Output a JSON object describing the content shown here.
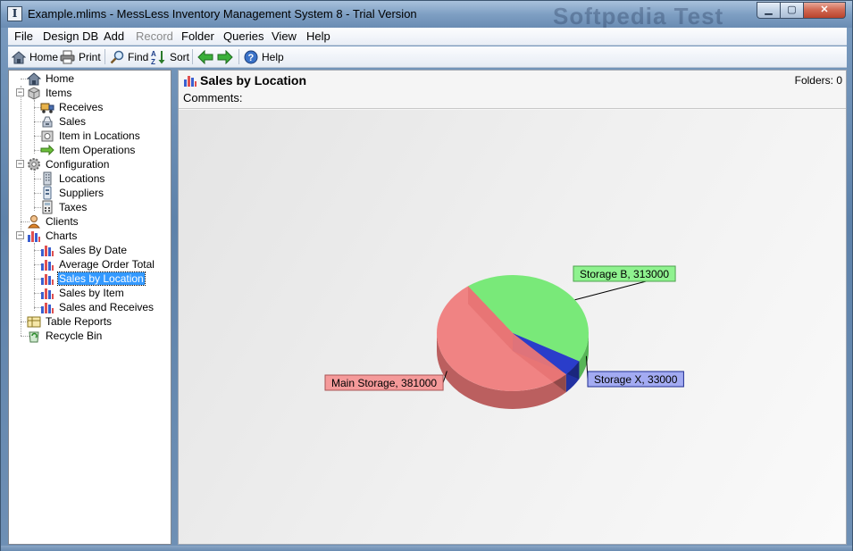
{
  "window": {
    "title": "Example.mlims - MessLess Inventory Management System 8 - Trial Version",
    "watermark": "Softpedia Test",
    "min_glyph": "▁",
    "max_glyph": "▢",
    "close_glyph": "✕"
  },
  "menubar": {
    "items": [
      {
        "label": "File",
        "enabled": true
      },
      {
        "label": "Design DB",
        "enabled": true
      },
      {
        "label": "Add",
        "enabled": true
      },
      {
        "label": "Record",
        "enabled": false
      },
      {
        "label": "Folder",
        "enabled": true
      },
      {
        "label": "Queries",
        "enabled": true
      },
      {
        "label": "View",
        "enabled": true
      },
      {
        "label": "Help",
        "enabled": true
      }
    ]
  },
  "toolbar": {
    "home_label": "Home",
    "print_label": "Print",
    "find_label": "Find",
    "sort_label": "Sort",
    "help_label": "Help"
  },
  "sidebar": {
    "items": [
      {
        "label": "Home",
        "icon": "home-icon"
      },
      {
        "label": "Items",
        "icon": "items-icon"
      },
      {
        "label": "Receives",
        "icon": "truck-icon"
      },
      {
        "label": "Sales",
        "icon": "sales-icon"
      },
      {
        "label": "Item in Locations",
        "icon": "item-location-icon"
      },
      {
        "label": "Item Operations",
        "icon": "arrow-right-icon"
      },
      {
        "label": "Configuration",
        "icon": "gear-icon"
      },
      {
        "label": "Locations",
        "icon": "building-icon"
      },
      {
        "label": "Suppliers",
        "icon": "supplier-icon"
      },
      {
        "label": "Taxes",
        "icon": "calculator-icon"
      },
      {
        "label": "Clients",
        "icon": "person-icon"
      },
      {
        "label": "Charts",
        "icon": "chart-icon"
      },
      {
        "label": "Sales By Date",
        "icon": "chart-icon"
      },
      {
        "label": "Average Order Total",
        "icon": "chart-icon"
      },
      {
        "label": "Sales by Location",
        "icon": "chart-icon",
        "selected": true
      },
      {
        "label": "Sales by Item",
        "icon": "chart-icon"
      },
      {
        "label": "Sales and Receives",
        "icon": "chart-icon"
      },
      {
        "label": "Table Reports",
        "icon": "report-icon"
      },
      {
        "label": "Recycle Bin",
        "icon": "recycle-bin-icon"
      }
    ]
  },
  "main": {
    "title": "Sales by Location",
    "folders": "Folders: 0",
    "comments_label": "Comments:"
  },
  "chart_data": {
    "type": "pie",
    "title": "",
    "slices": [
      {
        "name": "Main Storage",
        "value": 381000,
        "label": "Main Storage, 381000",
        "color": "#f07a7a"
      },
      {
        "name": "Storage B",
        "value": 313000,
        "label": "Storage B, 313000",
        "color": "#6fe86f"
      },
      {
        "name": "Storage X",
        "value": 33000,
        "label": "Storage X, 33000",
        "color": "#2b3fd0"
      }
    ]
  },
  "colors": {
    "selection": "#3399ff",
    "title_bar": "#7e9fc3"
  }
}
